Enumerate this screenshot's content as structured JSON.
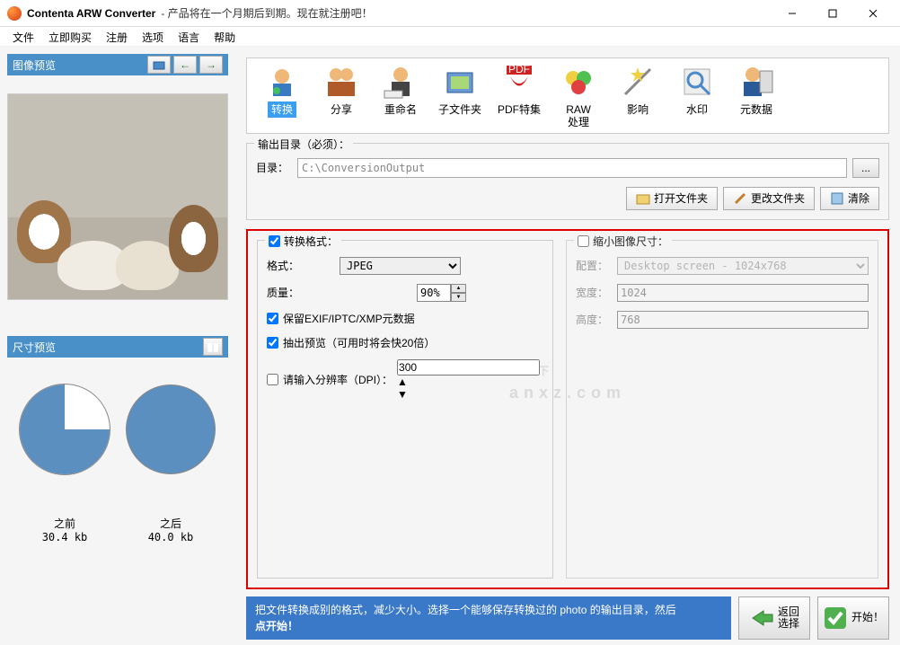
{
  "title": "Contenta ARW Converter",
  "subtitle": " - 产品将在一个月期后到期。现在就注册吧！",
  "menu": [
    "文件",
    "立即购买",
    "注册",
    "选项",
    "语言",
    "帮助"
  ],
  "left": {
    "preview_label": "图像预览",
    "size_preview_label": "尺寸预览",
    "before_label": "之前",
    "before_size": "30.4 kb",
    "after_label": "之后",
    "after_size": "40.0 kb"
  },
  "tabs": [
    {
      "label": "转换",
      "active": true
    },
    {
      "label": "分享"
    },
    {
      "label": "重命名"
    },
    {
      "label": "子文件夹"
    },
    {
      "label": "PDF特集"
    },
    {
      "label": "RAW\n处理"
    },
    {
      "label": "影响"
    },
    {
      "label": "水印"
    },
    {
      "label": "元数据"
    }
  ],
  "output": {
    "legend": "输出目录（必须）：",
    "dir_label": "目录：",
    "dir_value": "C:\\ConversionOutput",
    "open_folder": "打开文件夹",
    "change_folder": "更改文件夹",
    "clear": "清除"
  },
  "convert": {
    "legend": "转换格式：",
    "format_label": "格式：",
    "format_value": "JPEG",
    "quality_label": "质量：",
    "quality_value": "90%",
    "keep_exif": "保留EXIF/IPTC/XMP元数据",
    "extract_preview": "抽出预览（可用时将会快20倍）",
    "dpi_label": "请输入分辨率（DPI）：",
    "dpi_value": "300"
  },
  "shrink": {
    "legend": "缩小图像尺寸：",
    "preset_label": "配置：",
    "preset_value": "Desktop screen - 1024x768",
    "width_label": "宽度：",
    "width_value": "1024",
    "height_label": "高度：",
    "height_value": "768"
  },
  "tip": {
    "text1": "把文件转换成别的格式，减少大小。选择一个能够保存转换过的 photo 的输出目录，然后",
    "text2": "点开始！"
  },
  "buttons": {
    "back": "返回\n选择",
    "start": "开始！"
  },
  "watermark": "安　下",
  "watermark_sub": "anxz.com"
}
